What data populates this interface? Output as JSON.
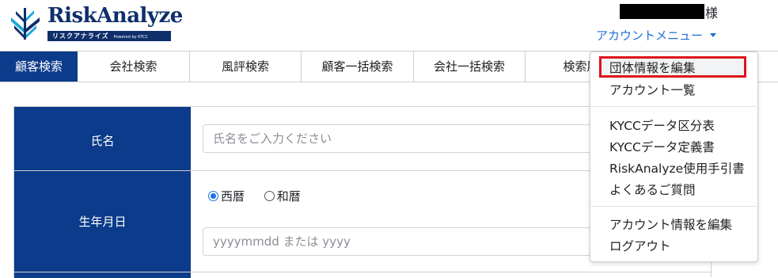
{
  "header": {
    "logo_title": "RiskAnalyze",
    "logo_sub": "リスクアナライズ",
    "logo_powered": "Powered by KYCC",
    "user_suffix": "様",
    "account_menu_label": "アカウントメニュー"
  },
  "tabs": [
    {
      "label": "顧客検索",
      "active": true
    },
    {
      "label": "会社検索"
    },
    {
      "label": "風評検索"
    },
    {
      "label": "顧客一括検索"
    },
    {
      "label": "会社一括検索"
    },
    {
      "label": "検索履"
    }
  ],
  "form": {
    "name_label": "氏名",
    "name_placeholder": "氏名をご入力ください",
    "birth_label": "生年月日",
    "era_options": [
      {
        "label": "西暦",
        "checked": true
      },
      {
        "label": "和暦",
        "checked": false
      }
    ],
    "birth_placeholder": "yyyymmdd または yyyy"
  },
  "dropdown": {
    "items": [
      "団体情報を編集",
      "アカウント一覧",
      "KYCCデータ区分表",
      "KYCCデータ定義書",
      "RiskAnalyze使用手引書",
      "よくあるご質問",
      "アカウント情報を編集",
      "ログアウト"
    ]
  },
  "colors": {
    "brand_navy": "#0b3b8a",
    "link_blue": "#1f6fd1",
    "highlight_red": "#e0121b"
  }
}
